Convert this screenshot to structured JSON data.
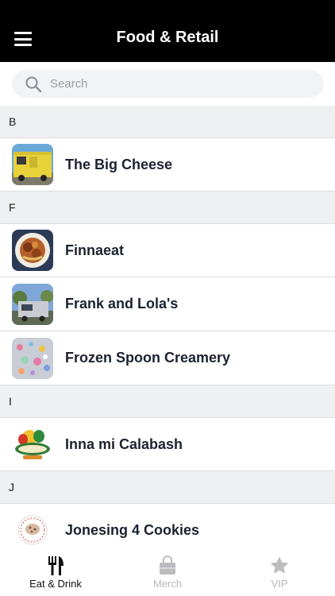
{
  "header": {
    "title": "Food & Retail",
    "menu_icon": "hamburger-menu-icon"
  },
  "search": {
    "placeholder": "Search",
    "value": ""
  },
  "sections": [
    {
      "letter": "B",
      "items": [
        {
          "name": "The Big Cheese",
          "thumb": "yellow-food-truck"
        }
      ]
    },
    {
      "letter": "F",
      "items": [
        {
          "name": "Finnaeat",
          "thumb": "plated-dish"
        },
        {
          "name": "Frank and Lola's",
          "thumb": "silver-food-truck"
        },
        {
          "name": "Frozen Spoon Creamery",
          "thumb": "ice-cream-sprinkles"
        }
      ]
    },
    {
      "letter": "I",
      "items": [
        {
          "name": "Inna mi Calabash",
          "thumb": "inna-mi-logo"
        }
      ]
    },
    {
      "letter": "J",
      "items": [
        {
          "name": "Jonesing 4 Cookies",
          "thumb": "cookie-logo"
        }
      ]
    }
  ],
  "tabs": [
    {
      "label": "Eat & Drink",
      "icon": "fork-knife-icon",
      "active": true
    },
    {
      "label": "Merch",
      "icon": "shopping-bag-icon",
      "active": false
    },
    {
      "label": "VIP",
      "icon": "star-icon",
      "active": false
    }
  ],
  "colors": {
    "header_bg": "#000000",
    "section_bg": "#eff0f2",
    "active_tab": "#111111",
    "inactive_tab": "#b8b8bc"
  }
}
